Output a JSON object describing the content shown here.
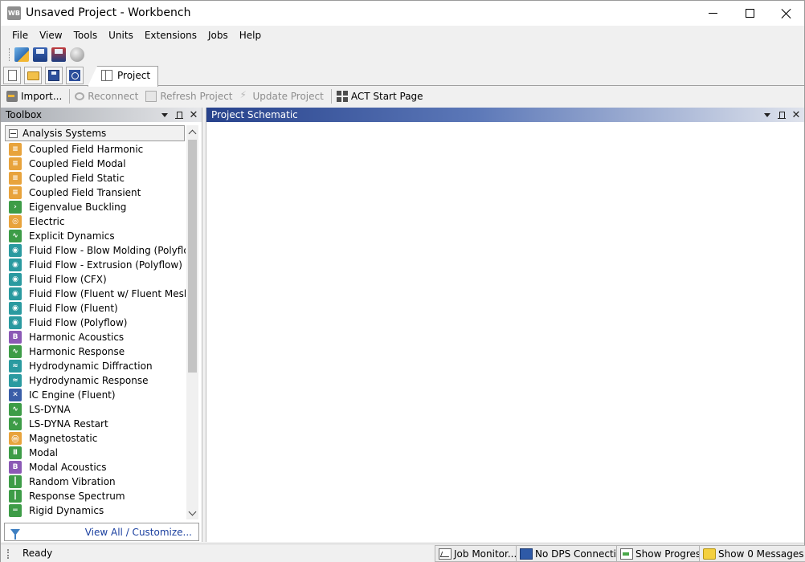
{
  "window": {
    "title": "Unsaved Project - Workbench",
    "app_icon_text": "WB"
  },
  "menu": [
    "File",
    "View",
    "Tools",
    "Units",
    "Extensions",
    "Jobs",
    "Help"
  ],
  "tabs": {
    "project_label": "Project"
  },
  "commands": {
    "import": "Import...",
    "reconnect": "Reconnect",
    "refresh": "Refresh Project",
    "update": "Update Project",
    "act_start": "ACT Start Page"
  },
  "toolbox": {
    "title": "Toolbox",
    "group_label": "Analysis Systems",
    "items": [
      {
        "label": "Coupled Field Harmonic",
        "icon": "coupled-field-icon",
        "color": "#e8a33c"
      },
      {
        "label": "Coupled Field Modal",
        "icon": "coupled-field-icon",
        "color": "#e8a33c"
      },
      {
        "label": "Coupled Field Static",
        "icon": "coupled-field-icon",
        "color": "#e8a33c"
      },
      {
        "label": "Coupled Field Transient",
        "icon": "coupled-field-icon",
        "color": "#e8a33c"
      },
      {
        "label": "Eigenvalue Buckling",
        "icon": "eigenvalue-icon",
        "color": "#3d9c47"
      },
      {
        "label": "Electric",
        "icon": "electric-icon",
        "color": "#e8a33c"
      },
      {
        "label": "Explicit Dynamics",
        "icon": "explicit-dynamics-icon",
        "color": "#3d9c47"
      },
      {
        "label": "Fluid Flow - Blow Molding (Polyflow)",
        "icon": "fluid-flow-icon",
        "color": "#2a9aa0"
      },
      {
        "label": "Fluid Flow - Extrusion (Polyflow)",
        "icon": "fluid-flow-icon",
        "color": "#2a9aa0"
      },
      {
        "label": "Fluid Flow (CFX)",
        "icon": "fluid-flow-icon",
        "color": "#2a9aa0"
      },
      {
        "label": "Fluid Flow (Fluent w/ Fluent Meshing) (I",
        "icon": "fluid-flow-icon",
        "color": "#2a9aa0"
      },
      {
        "label": "Fluid Flow (Fluent)",
        "icon": "fluid-flow-icon",
        "color": "#2a9aa0"
      },
      {
        "label": "Fluid Flow (Polyflow)",
        "icon": "fluid-flow-icon",
        "color": "#2a9aa0"
      },
      {
        "label": "Harmonic Acoustics",
        "icon": "acoustics-icon",
        "color": "#8b59b5"
      },
      {
        "label": "Harmonic Response",
        "icon": "harmonic-response-icon",
        "color": "#3d9c47"
      },
      {
        "label": "Hydrodynamic Diffraction",
        "icon": "hydrodynamic-icon",
        "color": "#2a9aa0"
      },
      {
        "label": "Hydrodynamic Response",
        "icon": "hydrodynamic-icon",
        "color": "#2a9aa0"
      },
      {
        "label": "IC Engine (Fluent)",
        "icon": "ic-engine-icon",
        "color": "#3a5ea8"
      },
      {
        "label": "LS-DYNA",
        "icon": "ls-dyna-icon",
        "color": "#3d9c47"
      },
      {
        "label": "LS-DYNA Restart",
        "icon": "ls-dyna-icon",
        "color": "#3d9c47"
      },
      {
        "label": "Magnetostatic",
        "icon": "magnetostatic-icon",
        "color": "#e8a33c"
      },
      {
        "label": "Modal",
        "icon": "modal-icon",
        "color": "#3d9c47"
      },
      {
        "label": "Modal Acoustics",
        "icon": "acoustics-icon",
        "color": "#8b59b5"
      },
      {
        "label": "Random Vibration",
        "icon": "random-vibration-icon",
        "color": "#3d9c47"
      },
      {
        "label": "Response Spectrum",
        "icon": "response-spectrum-icon",
        "color": "#3d9c47"
      },
      {
        "label": "Rigid Dynamics",
        "icon": "rigid-dynamics-icon",
        "color": "#3d9c47"
      }
    ],
    "footer_link": "View All / Customize..."
  },
  "schematic": {
    "title": "Project Schematic"
  },
  "status": {
    "text": "Ready",
    "job_monitor": "Job Monitor...",
    "dps": "No DPS Connection",
    "progress": "Show Progress",
    "messages": "Show 0 Messages"
  }
}
